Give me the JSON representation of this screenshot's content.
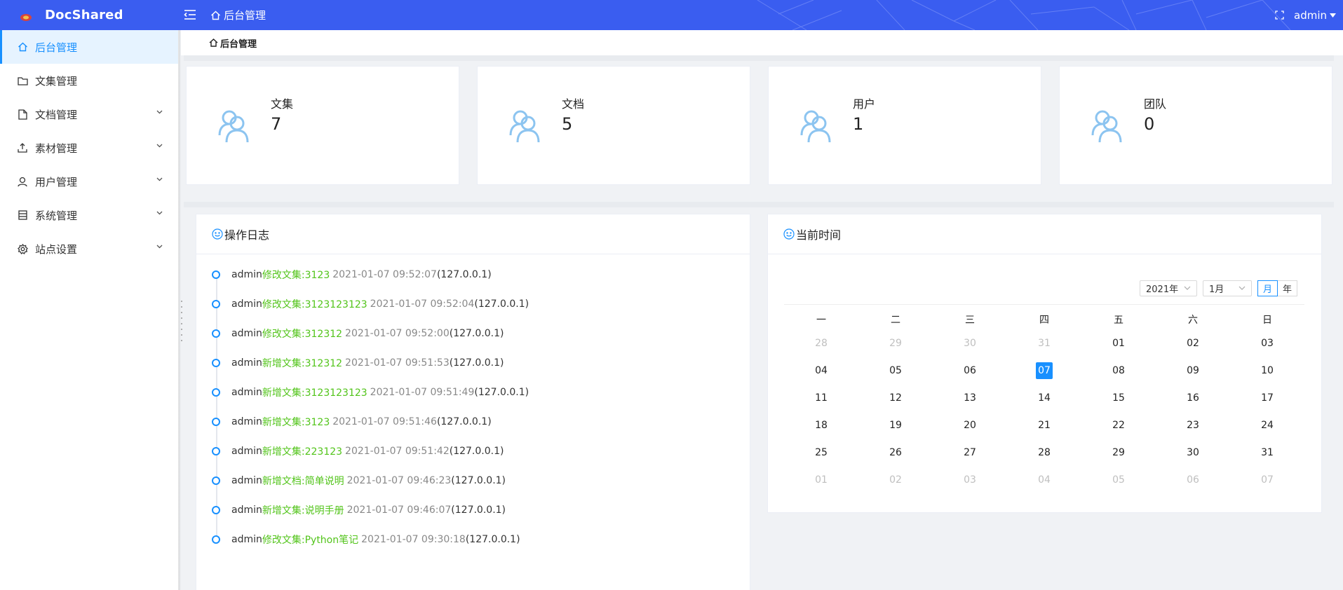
{
  "app": {
    "name": "DocShared"
  },
  "header": {
    "breadcrumb": "后台管理",
    "user": "admin"
  },
  "sidebar": {
    "items": [
      {
        "label": "后台管理",
        "icon": "home-icon",
        "active": true
      },
      {
        "label": "文集管理",
        "icon": "folder-icon"
      },
      {
        "label": "文档管理",
        "icon": "file-icon"
      },
      {
        "label": "素材管理",
        "icon": "upload-icon"
      },
      {
        "label": "用户管理",
        "icon": "user-icon"
      },
      {
        "label": "系统管理",
        "icon": "list-icon"
      },
      {
        "label": "站点设置",
        "icon": "gear-icon"
      }
    ]
  },
  "breadcrumb": {
    "label": "后台管理"
  },
  "stats": [
    {
      "label": "文集",
      "value": "7"
    },
    {
      "label": "文档",
      "value": "5"
    },
    {
      "label": "用户",
      "value": "1"
    },
    {
      "label": "团队",
      "value": "0"
    }
  ],
  "log_panel": {
    "title": "操作日志",
    "entries": [
      {
        "user": "admin",
        "action": "修改文集:3123",
        "time": "2021-01-07 09:52:07",
        "ip": "(127.0.0.1)"
      },
      {
        "user": "admin",
        "action": "修改文集:3123123123",
        "time": "2021-01-07 09:52:04",
        "ip": "(127.0.0.1)"
      },
      {
        "user": "admin",
        "action": "修改文集:312312",
        "time": "2021-01-07 09:52:00",
        "ip": "(127.0.0.1)"
      },
      {
        "user": "admin",
        "action": "新增文集:312312",
        "time": "2021-01-07 09:51:53",
        "ip": "(127.0.0.1)"
      },
      {
        "user": "admin",
        "action": "新增文集:3123123123",
        "time": "2021-01-07 09:51:49",
        "ip": "(127.0.0.1)"
      },
      {
        "user": "admin",
        "action": "新增文集:3123",
        "time": "2021-01-07 09:51:46",
        "ip": "(127.0.0.1)"
      },
      {
        "user": "admin",
        "action": "新增文集:223123",
        "time": "2021-01-07 09:51:42",
        "ip": "(127.0.0.1)"
      },
      {
        "user": "admin",
        "action": "新增文档:简单说明",
        "time": "2021-01-07 09:46:23",
        "ip": "(127.0.0.1)"
      },
      {
        "user": "admin",
        "action": "新增文集:说明手册",
        "time": "2021-01-07 09:46:07",
        "ip": "(127.0.0.1)"
      },
      {
        "user": "admin",
        "action": "修改文集:Python笔记",
        "time": "2021-01-07 09:30:18",
        "ip": "(127.0.0.1)"
      }
    ]
  },
  "calendar_panel": {
    "title": "当前时间",
    "year_select": "2021年",
    "month_select": "1月",
    "mode_month": "月",
    "mode_year": "年",
    "weekdays": [
      "一",
      "二",
      "三",
      "四",
      "五",
      "六",
      "日"
    ],
    "selected_day": "07",
    "weeks": [
      [
        {
          "d": "28",
          "dim": true
        },
        {
          "d": "29",
          "dim": true
        },
        {
          "d": "30",
          "dim": true
        },
        {
          "d": "31",
          "dim": true
        },
        {
          "d": "01"
        },
        {
          "d": "02"
        },
        {
          "d": "03"
        }
      ],
      [
        {
          "d": "04"
        },
        {
          "d": "05"
        },
        {
          "d": "06"
        },
        {
          "d": "07",
          "selected": true
        },
        {
          "d": "08"
        },
        {
          "d": "09"
        },
        {
          "d": "10"
        }
      ],
      [
        {
          "d": "11"
        },
        {
          "d": "12"
        },
        {
          "d": "13"
        },
        {
          "d": "14"
        },
        {
          "d": "15"
        },
        {
          "d": "16"
        },
        {
          "d": "17"
        }
      ],
      [
        {
          "d": "18"
        },
        {
          "d": "19"
        },
        {
          "d": "20"
        },
        {
          "d": "21"
        },
        {
          "d": "22"
        },
        {
          "d": "23"
        },
        {
          "d": "24"
        }
      ],
      [
        {
          "d": "25"
        },
        {
          "d": "26"
        },
        {
          "d": "27"
        },
        {
          "d": "28"
        },
        {
          "d": "29"
        },
        {
          "d": "30"
        },
        {
          "d": "31"
        }
      ],
      [
        {
          "d": "01",
          "dim": true
        },
        {
          "d": "02",
          "dim": true
        },
        {
          "d": "03",
          "dim": true
        },
        {
          "d": "04",
          "dim": true
        },
        {
          "d": "05",
          "dim": true
        },
        {
          "d": "06",
          "dim": true
        },
        {
          "d": "07",
          "dim": true
        }
      ]
    ]
  },
  "colors": {
    "header": "#3a5df0",
    "accent": "#1890ff",
    "action_green": "#52c41a",
    "stat_icon": "#8cc4f0"
  }
}
